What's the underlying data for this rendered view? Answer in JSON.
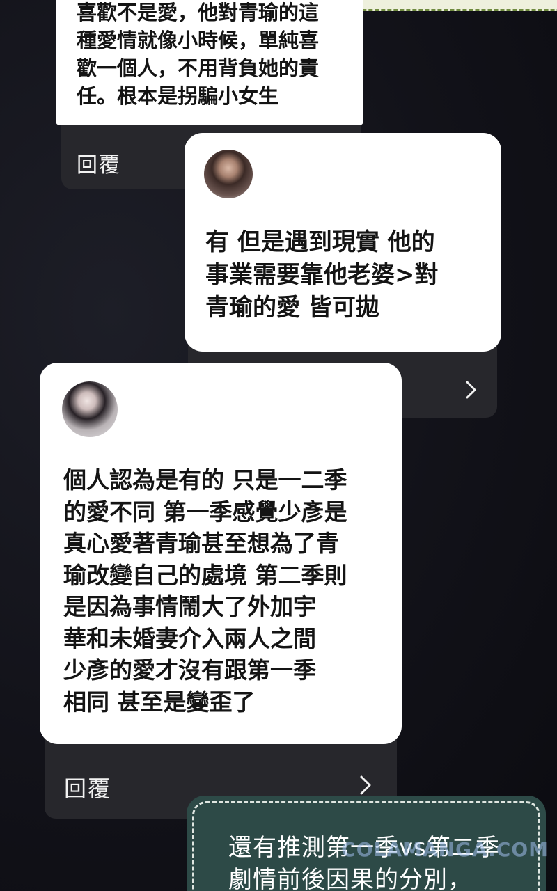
{
  "comment_1": {
    "text": "喜歡不是愛，他對青瑜的這\n種愛情就像小時候，單純喜\n歡一個人，不用背負她的責\n任。根本是拐騙小女生",
    "reply_label": "回覆"
  },
  "comment_2": {
    "text": "有 但是遇到現實 他的\n事業需要靠他老婆>對\n青瑜的愛 皆可拋",
    "avatar_icon": "user-avatar",
    "chevron_icon": "chevron-right-icon"
  },
  "comment_3": {
    "text": "個人認為是有的 只是一二季\n的愛不同 第一季感覺少彥是\n真心愛著青瑜甚至想為了青\n瑜改變自己的處境 第二季則\n是因為事情鬧大了外加宇\n華和未婚妻介入兩人之間\n少彥的愛才沒有跟第一季\n相同 甚至是變歪了",
    "reply_label": "回覆",
    "avatar_icon": "user-avatar",
    "chevron_icon": "chevron-right-icon"
  },
  "note": {
    "text": "還有推測第一季vs第二季\n劇情前後因果的分別，"
  },
  "watermark": {
    "text": "COLAMANGA.COM"
  },
  "colors": {
    "background": "#121219",
    "card": "#ffffff",
    "reply_panel": "#27272c",
    "note": "#2d4a47",
    "banner_border": "#6f8a3f"
  }
}
